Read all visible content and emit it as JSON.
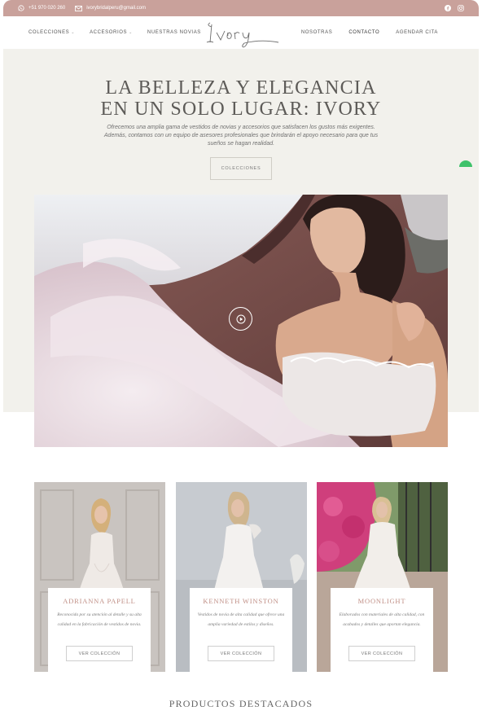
{
  "topbar": {
    "phone": "+51 970 020 260",
    "email": "ivorybridalperu@gmail.com",
    "social": [
      "facebook-icon",
      "instagram-icon"
    ],
    "color": "#c9a19b"
  },
  "nav": {
    "left": [
      {
        "label": "COLECCIONES",
        "caret": "⌄"
      },
      {
        "label": "ACCESORIOS",
        "caret": "⌄"
      },
      {
        "label": "NUESTRAS NOVIAS"
      }
    ],
    "logo": "Ivory",
    "right": [
      {
        "label": "NOSOTRAS"
      },
      {
        "label": "CONTACTO"
      },
      {
        "label": "AGENDAR CITA"
      }
    ]
  },
  "hero": {
    "title_line1": "LA BELLEZA Y ELEGANCIA",
    "title_line2": "EN UN SOLO LUGAR: IVORY",
    "description": "Ofrecemos una amplia gama de vestidos de novias y accesorios que satisfacen los gustos más exigentes. Además, contamos con un equipo de asesores profesionales que brindarán el apoyo necesario para que tus sueños se hagan realidad.",
    "button": "COLECCIONES",
    "background": "#f2f1ec"
  },
  "video": {
    "play_icon": "play-circle-icon"
  },
  "cards": [
    {
      "title": "ADRIANNA PAPELL",
      "text": "Reconocida por su atención al detalle y su alta calidad en la fabricación de vestidos de novia.",
      "button": "VER COLECCIÓN"
    },
    {
      "title": "KENNETH WINSTON",
      "text": "Vestidos de novia de alta calidad que ofrece una amplia variedad de estilos y diseños.",
      "button": "VER COLECCIÓN"
    },
    {
      "title": "MOONLIGHT",
      "text": "Elaborados con materiales de alta calidad, con acabados y detalles que aportan elegancia.",
      "button": "VER COLECCIÓN"
    }
  ],
  "accent_color": "#c08f86",
  "section_title": "PRODUCTOS DESTACADOS"
}
